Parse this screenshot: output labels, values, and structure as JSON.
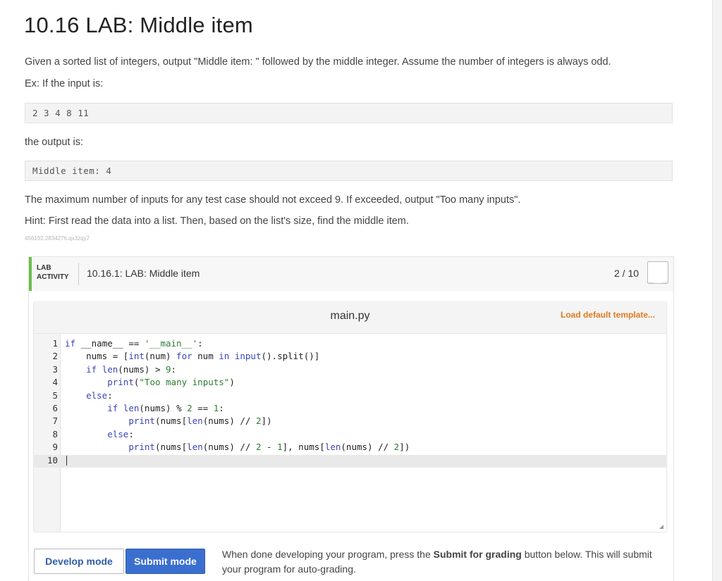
{
  "page": {
    "title": "10.16 LAB: Middle item",
    "description": "Given a sorted list of integers, output \"Middle item: \" followed by the middle integer. Assume the number of integers is always odd.",
    "example_intro": "Ex: If the input is:",
    "example_input": "2 3 4 8 11",
    "output_intro": "the output is:",
    "example_output": "Middle item: 4",
    "limit_text": "The maximum number of inputs for any test case should not exceed 9. If exceeded, output \"Too many inputs\".",
    "hint_text": "Hint: First read the data into a list. Then, based on the list's size, find the middle item.",
    "small_id": "456192.2834276.qx3zqy7"
  },
  "activity": {
    "tag_line1": "LAB",
    "tag_line2": "ACTIVITY",
    "title": "10.16.1: LAB: Middle item",
    "score": "2 / 10"
  },
  "editor": {
    "filename": "main.py",
    "load_template_label": "Load default template...",
    "line_numbers": [
      "1",
      "2",
      "3",
      "4",
      "5",
      "6",
      "7",
      "8",
      "9",
      "10"
    ],
    "active_line": 10
  },
  "modes": {
    "develop_label": "Develop mode",
    "submit_label": "Submit mode"
  },
  "instructions": {
    "part1": "When done developing your program, press the ",
    "bold": "Submit for grading",
    "part2": " button below. This will submit your program for auto-grading."
  },
  "colors": {
    "accent_green": "#6bbf4a",
    "link_orange": "#e07a1f",
    "submit_blue": "#3b6fcf",
    "keyword_blue": "#3b46b8",
    "string_green": "#2e7d32"
  }
}
